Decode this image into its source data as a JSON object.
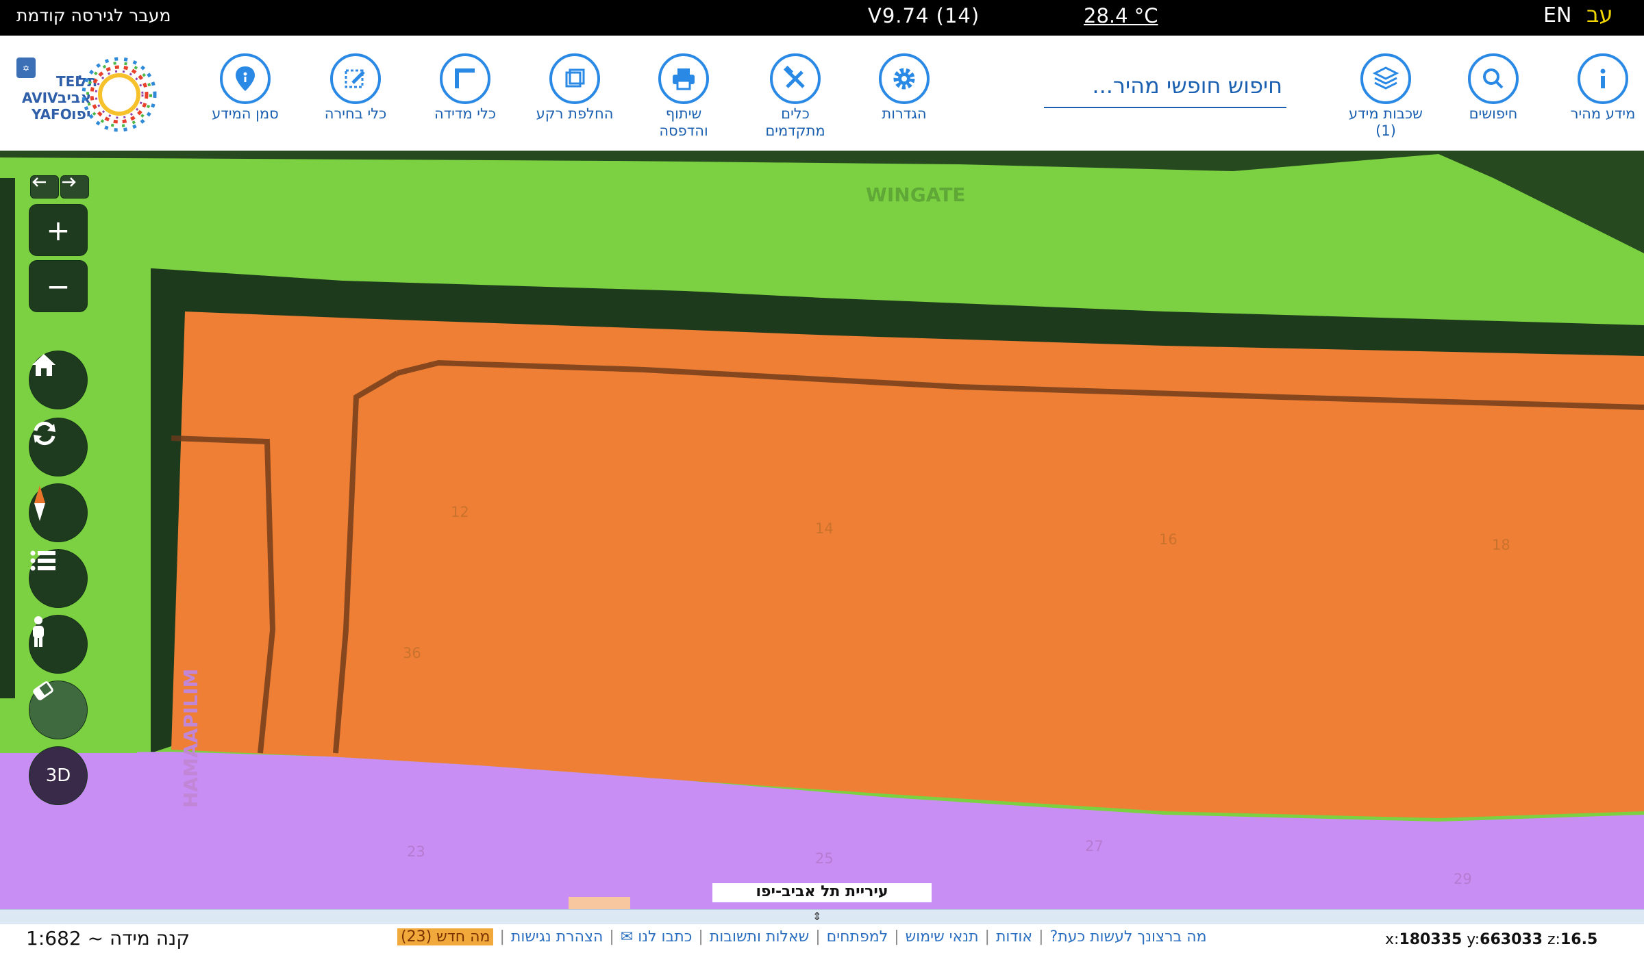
{
  "topbar": {
    "prev_version": "מעבר לגירסה קודמת",
    "version": "V9.74 (14)",
    "temperature": "28.4 °C",
    "lang_en": "EN",
    "lang_he": "עב"
  },
  "toolbar": {
    "search_placeholder": "חיפוש חופשי מהיר...",
    "tools": [
      {
        "label": "מידע מהיר",
        "icon": "info-icon"
      },
      {
        "label": "חיפושים",
        "icon": "search-icon"
      },
      {
        "label": "שכבות מידע\n(1)",
        "icon": "layers-icon"
      },
      {
        "label": "הגדרות",
        "icon": "gear-icon"
      },
      {
        "label": "כלים\nמתקדמים",
        "icon": "tools-icon"
      },
      {
        "label": "שיתוף\nוהדפסה",
        "icon": "printer-icon"
      },
      {
        "label": "החלפת רקע",
        "icon": "basemap-icon"
      },
      {
        "label": "כלי מדידה",
        "icon": "ruler-icon"
      },
      {
        "label": "כלי בחירה",
        "icon": "select-icon"
      },
      {
        "label": "סמן המידע",
        "icon": "pin-icon"
      }
    ],
    "logo_text": "TEL AVIV YAFO תל אביב יפו"
  },
  "map": {
    "streets": {
      "top": "WINGATE",
      "left": "HAMAAPILIM"
    },
    "parcels_orange": [
      "12",
      "14",
      "16",
      "18",
      "36"
    ],
    "parcels_purple": [
      "23",
      "25",
      "27",
      "29"
    ],
    "colors": {
      "green": "#7bd141",
      "orange": "#ef7f35",
      "purple": "#c98ef3",
      "border": "#1d3a1d"
    },
    "city_name": "עיריית תל אביב-יפו"
  },
  "controls": {
    "zoom_in": "+",
    "zoom_out": "−",
    "btn_3d": "3D"
  },
  "footer": {
    "scale_label": "קנה מידה ~ 1:682",
    "links": [
      "מה ברצונך לעשות כעת?",
      "אודות",
      "תנאי שימוש",
      "למפתחים",
      "שאלות ותשובות",
      "כתבו לנו ✉",
      "הצהרת נגישות"
    ],
    "whats_new": "מה חדש (23)",
    "coord_x_label": "x:",
    "coord_x": "180335",
    "coord_y_label": "y:",
    "coord_y": "663033",
    "coord_z_label": "z:",
    "coord_z": "16.5"
  }
}
